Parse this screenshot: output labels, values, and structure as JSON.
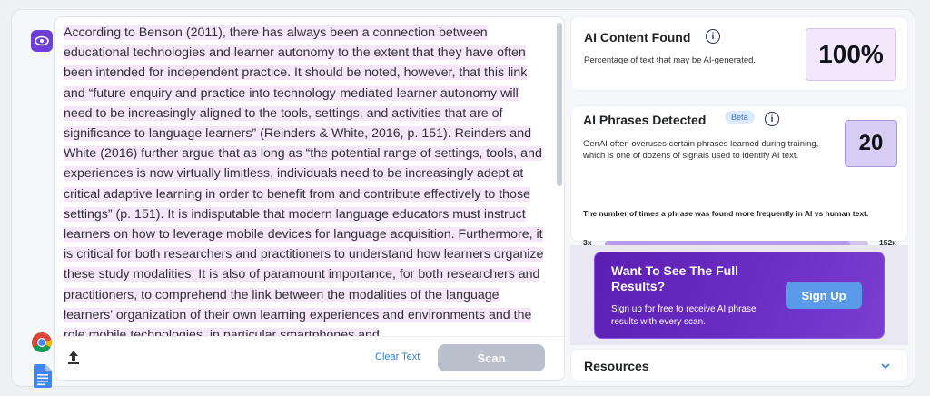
{
  "editor": {
    "paragraph": "According to Benson (2011), there has always been a connection between educational technologies and learner autonomy to the extent that they have often been intended for independent practice. It should be noted, however, that this link and “future enquiry and practice into technology-mediated learner autonomy will need to be increasingly aligned to the tools, settings, and activities that are of significance to language learners” (Reinders & White, 2016, p. 151). Reinders and White (2016) further argue that as long as “the potential range of settings, tools, and experiences is now virtually limitless, individuals need to be increasingly adept at critical adaptive learning in order to benefit from and contribute effectively to those settings” (p. 151). It is indisputable that modern language educators must instruct learners on how to leverage mobile devices for language acquisition. Furthermore, it is critical for both researchers and practitioners to understand how learners organize these study modalities. It is also of paramount importance, for both researchers and practitioners, to comprehend the link between the modalities of the language learners' organization of their own learning experiences and environments and the role mobile technologies, in particular smartphones and",
    "clear_label": "Clear Text",
    "scan_label": "Scan"
  },
  "ai_content": {
    "title": "AI Content Found",
    "description": "Percentage of text that may be AI-generated.",
    "percent": "100%"
  },
  "ai_phrases": {
    "title": "AI Phrases Detected",
    "badge": "Beta",
    "description": "GenAI often overuses certain phrases learned during training, which is one of dozens of signals used to identify AI text.",
    "count": "20",
    "range_label": "The number of times a phrase was found more frequently in AI vs human text.",
    "range_min": "3x",
    "range_max": "152x",
    "range_fill_fraction": 0.93
  },
  "promo": {
    "title": "Want To See The Full Results?",
    "description": "Sign up for free to receive AI phrase results with every scan.",
    "button": "Sign Up"
  },
  "resources": {
    "title": "Resources"
  },
  "colors": {
    "accent": "#6d3fd6",
    "highlight": "#f6e6fa",
    "promo": "#5b1fb3",
    "link": "#3a7bd5"
  }
}
